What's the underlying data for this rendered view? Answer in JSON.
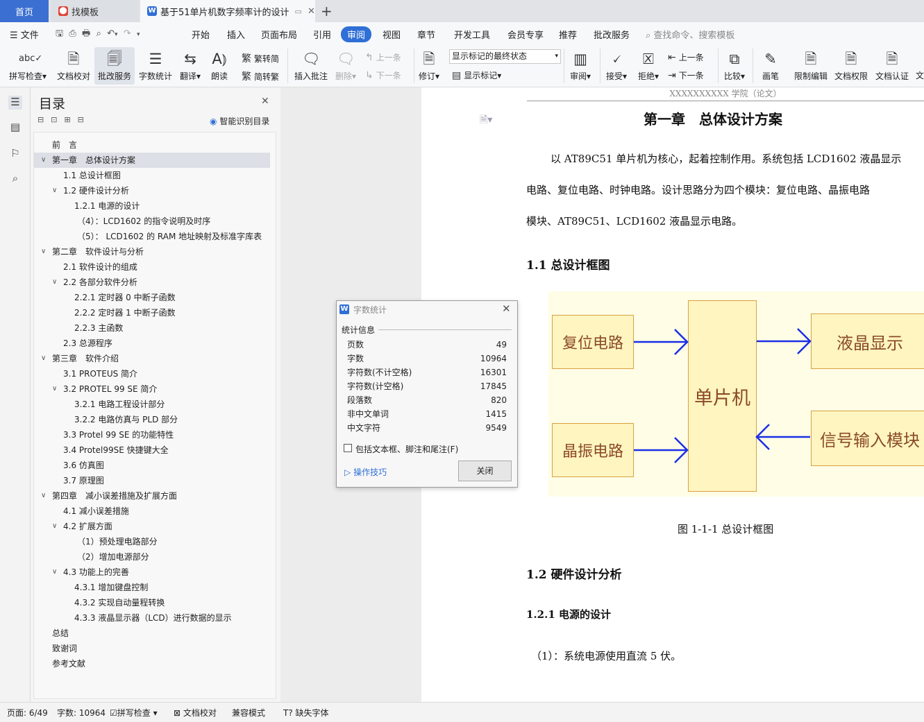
{
  "tabs": {
    "home": "首页",
    "templates": "找模板",
    "document": "基于51单片机数字频率计的设计",
    "add": "+"
  },
  "menu": {
    "file": "文件",
    "items": [
      "开始",
      "插入",
      "页面布局",
      "引用",
      "审阅",
      "视图",
      "章节",
      "开发工具",
      "会员专享",
      "推荐",
      "批改服务"
    ],
    "active": "审阅",
    "search": "查找命令、搜索模板"
  },
  "ribbon": {
    "spell": "拼写检查",
    "proof": "文档校对",
    "correct": "批改服务",
    "wordcount": "字数统计",
    "translate": "翻译",
    "read": "朗读",
    "trad": "繁转简",
    "simp": "简转繁",
    "insert_comment": "插入批注",
    "delete": "删除",
    "prev": "上一条",
    "next": "下一条",
    "revise": "修订",
    "show_state": "显示标记的最终状态",
    "show_marks": "显示标记",
    "review": "审阅",
    "accept": "接受",
    "reject": "拒绝",
    "prev2": "上一条",
    "next2": "下一条",
    "compare": "比较",
    "pen": "画笔",
    "restrict": "限制编辑",
    "perm": "文档权限",
    "cert": "文档认证",
    "more": "文"
  },
  "toc": {
    "title": "目录",
    "smart": "智能识别目录",
    "items": [
      "前　言",
      "第一章　总体设计方案",
      "1.1  总设计框图",
      "1.2  硬件设计分析",
      "1.2.1  电源的设计",
      "（4）：LCD1602 的指令说明及时序",
      "（5）：  LCD1602 的 RAM 地址映射及标准字库表",
      "第二章　软件设计与分析",
      "2.1  软件设计的组成",
      "2.2    各部分软件分析",
      "2.2.1    定时器 0 中断子函数",
      "2.2.2    定时器 1 中断子函数",
      "2.2.3    主函数",
      "2.3    总源程序",
      "第三章　软件介绍",
      "3.1 PROTEUS 简介",
      "3.2 PROTEL 99 SE 简介",
      "3.2.1  电路工程设计部分",
      "3.2.2  电路仿真与 PLD 部分",
      "3.3 Protel 99 SE 的功能特性",
      "3.4 Protel99SE 快捷键大全",
      "3.6 仿真图",
      "3.7 原理图",
      "第四章　减小误差措施及扩展方面",
      "4.1 减小误差措施",
      "4.2 扩展方面",
      "（1）预处理电路部分",
      "（2）增加电源部分",
      "4.3  功能上的完善",
      "4.3.1  增加键盘控制",
      "4.3.2  实现自动量程转换",
      "4.3.3  液晶显示器（LCD）进行数据的显示",
      "总结",
      "致谢词",
      "参考文献"
    ]
  },
  "document": {
    "header": "XXXXXXXXXX 学院（论文）",
    "chapter_title": "第一章　总体设计方案",
    "para_lines": [
      "以 AT89C51 单片机为核心，起着控制作用。系统包括 LCD1602 液晶显示",
      "电路、复位电路、时钟电路。设计思路分为四个模块：复位电路、晶振电路",
      "模块、AT89C51、LCD1602 液晶显示电路。"
    ],
    "h11": "1.1  总设计框图",
    "diagram": {
      "reset": "复位电路",
      "crystal": "晶振电路",
      "mcu": "单片机",
      "lcd": "液晶显示",
      "input": "信号输入模块"
    },
    "caption": "图 1-1-1 总设计框图",
    "h12": "1.2  硬件设计分析",
    "h121": "1.2.1  电源的设计",
    "p2": "（1）：系统电源使用直流 5 伏。"
  },
  "dialog": {
    "title": "字数统计",
    "section": "统计信息",
    "rows": [
      {
        "label": "页数",
        "value": "49"
      },
      {
        "label": "字数",
        "value": "10964"
      },
      {
        "label": "字符数(不计空格)",
        "value": "16301"
      },
      {
        "label": "字符数(计空格)",
        "value": "17845"
      },
      {
        "label": "段落数",
        "value": "820"
      },
      {
        "label": "非中文单词",
        "value": "1415"
      },
      {
        "label": "中文字符",
        "value": "9549"
      }
    ],
    "include": "包括文本框、脚注和尾注(F)",
    "tips": "操作技巧",
    "close": "关闭"
  },
  "status": {
    "page": "页面: 6/49",
    "words": "字数: 10964",
    "spell": "拼写检查",
    "proof": "文档校对",
    "compat": "兼容模式",
    "font": "缺失字体"
  },
  "colors": {
    "accent": "#2f6fd6",
    "diagram_bg": "#fffde6",
    "box_fill": "#fff5c0",
    "arrow": "#1a2ee8"
  }
}
